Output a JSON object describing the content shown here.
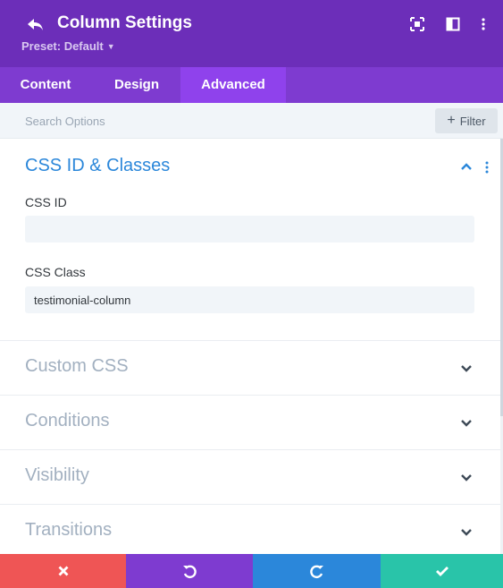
{
  "header": {
    "title": "Column Settings",
    "preset_label": "Preset: Default",
    "background": "#6c2eb9"
  },
  "tabs": [
    {
      "label": "Content",
      "active": false
    },
    {
      "label": "Design",
      "active": false
    },
    {
      "label": "Advanced",
      "active": true
    }
  ],
  "search": {
    "placeholder": "Search Options",
    "filter_label": "Filter"
  },
  "sections": {
    "css_id_classes": {
      "title": "CSS ID & Classes",
      "expanded": true,
      "css_id_label": "CSS ID",
      "css_id_value": "",
      "css_class_label": "CSS Class",
      "css_class_value": "testimonial-column"
    },
    "collapsed": [
      {
        "title": "Custom CSS"
      },
      {
        "title": "Conditions"
      },
      {
        "title": "Visibility"
      },
      {
        "title": "Transitions"
      }
    ]
  },
  "footer": {
    "buttons": [
      {
        "name": "discard",
        "icon": "close-icon",
        "color": "#ef5555"
      },
      {
        "name": "undo",
        "icon": "undo-icon",
        "color": "#7e3bd0"
      },
      {
        "name": "redo",
        "icon": "redo-icon",
        "color": "#2b87da"
      },
      {
        "name": "save",
        "icon": "check-icon",
        "color": "#29c4a9"
      }
    ]
  },
  "colors": {
    "accent_blue": "#2b87da",
    "purple_header": "#6c2eb9",
    "purple_tabs": "#7e3bd0",
    "active_tab": "#8f42ec"
  }
}
